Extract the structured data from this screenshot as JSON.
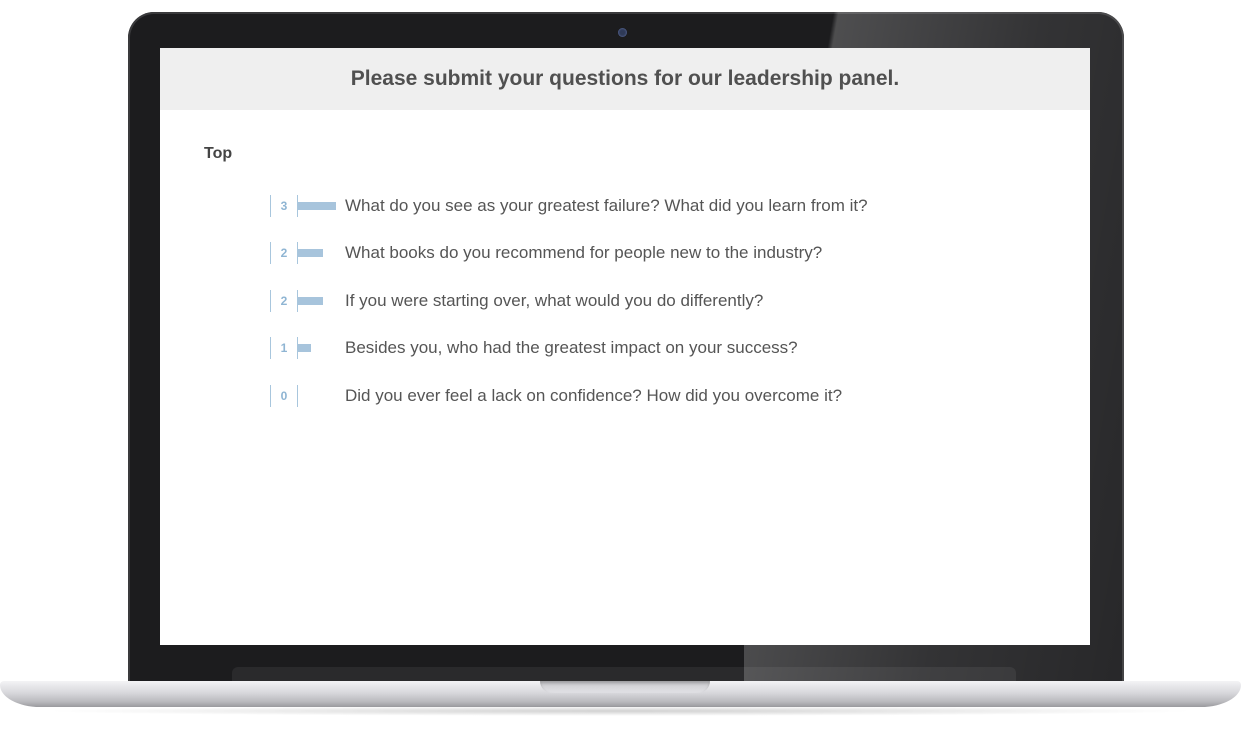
{
  "screen": {
    "title": "Please submit your questions for our leadership panel.",
    "section_label": "Top"
  },
  "questions": [
    {
      "votes": "3",
      "bar_fraction": 1.0,
      "text": "What do you see as your greatest failure? What did you learn from it?"
    },
    {
      "votes": "2",
      "bar_fraction": 0.667,
      "text": "What books do you recommend for people new to the industry?"
    },
    {
      "votes": "2",
      "bar_fraction": 0.667,
      "text": "If you were starting over, what would you do differently?"
    },
    {
      "votes": "1",
      "bar_fraction": 0.333,
      "text": "Besides you, who had the greatest impact on your success?"
    },
    {
      "votes": "0",
      "bar_fraction": 0.0,
      "text": "Did you ever feel a lack on confidence? How did you overcome it?"
    }
  ],
  "colors": {
    "header_bg": "#efefef",
    "accent": "#a7c4dc",
    "text": "#555555"
  },
  "icons": {
    "vote_bar": "horizontal-bar-icon"
  }
}
